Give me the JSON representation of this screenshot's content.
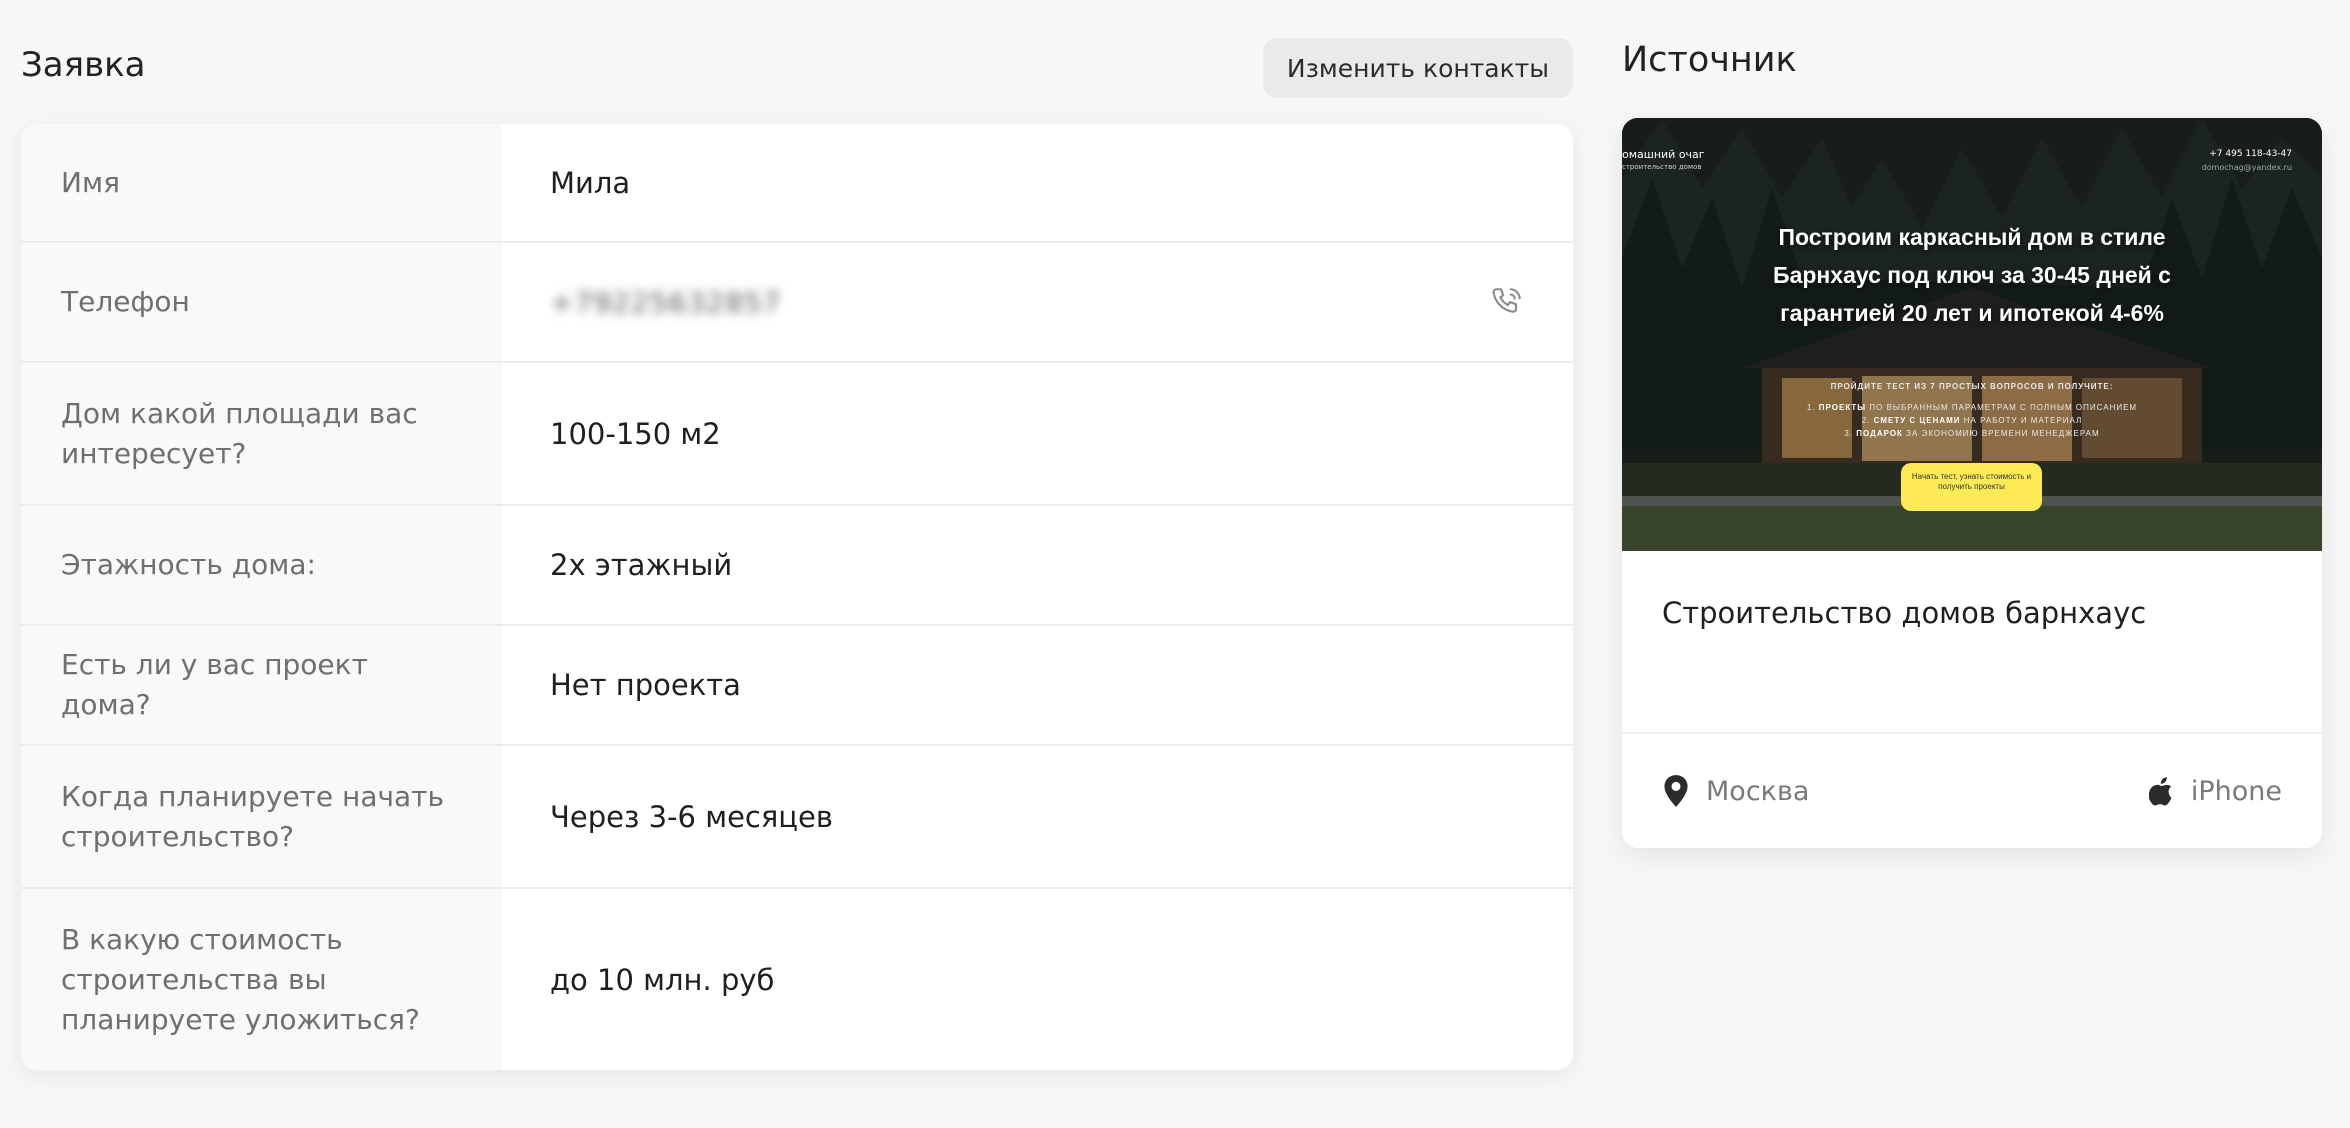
{
  "application": {
    "title": "Заявка",
    "edit_contacts_label": "Изменить контакты",
    "fields": [
      {
        "label": "Имя",
        "value": "Мила"
      },
      {
        "label": "Телефон",
        "value": "+79225632857"
      },
      {
        "label": "Дом какой площади вас интересует?",
        "value": "100-150 м2"
      },
      {
        "label": "Этажность дома:",
        "value": "2х этажный"
      },
      {
        "label": "Есть ли у вас проект дома?",
        "value": "Нет проекта"
      },
      {
        "label": "Когда планируете начать строительство?",
        "value": "Через 3-6 месяцев"
      },
      {
        "label": "В какую стоимость строительства вы планируете уложиться?",
        "value": "до 10 млн. руб"
      }
    ]
  },
  "source": {
    "title": "Источник",
    "preview": {
      "logo_name": "омашний очаг",
      "logo_sub": "строительство домов",
      "phone": "+7 495 118-43-47",
      "email": "domochag@yandex.ru",
      "headline": "Построим каркасный дом в стиле Барнхаус под ключ за 30-45 дней с гарантией 20 лет и ипотекой 4-6%",
      "subhead": "ПРОЙДИТЕ ТЕСТ ИЗ 7 ПРОСТЫХ ВОПРОСОВ И ПОЛУЧИТЕ:",
      "items": [
        {
          "num": "1.",
          "bold": "ПРОЕКТЫ",
          "text": "ПО ВЫБРАННЫМ ПАРАМЕТРАМ С ПОЛНЫМ ОПИСАНИЕМ"
        },
        {
          "num": "2.",
          "bold": "СМЕТУ С ЦЕНАМИ",
          "text": "НА РАБОТУ И МАТЕРИАЛ"
        },
        {
          "num": "3.",
          "bold": "ПОДАРОК",
          "text": "ЗА ЭКОНОМИЮ ВРЕМЕНИ МЕНЕДЖЕРАМ"
        }
      ],
      "cta": "Начать тест, узнать стоимость и получить проекты"
    },
    "site_title": "Строительство домов барнхаус",
    "location": "Москва",
    "device": "iPhone"
  },
  "icons": {
    "phone": "phone-call-icon",
    "location": "location-pin-icon",
    "device": "apple-icon"
  }
}
